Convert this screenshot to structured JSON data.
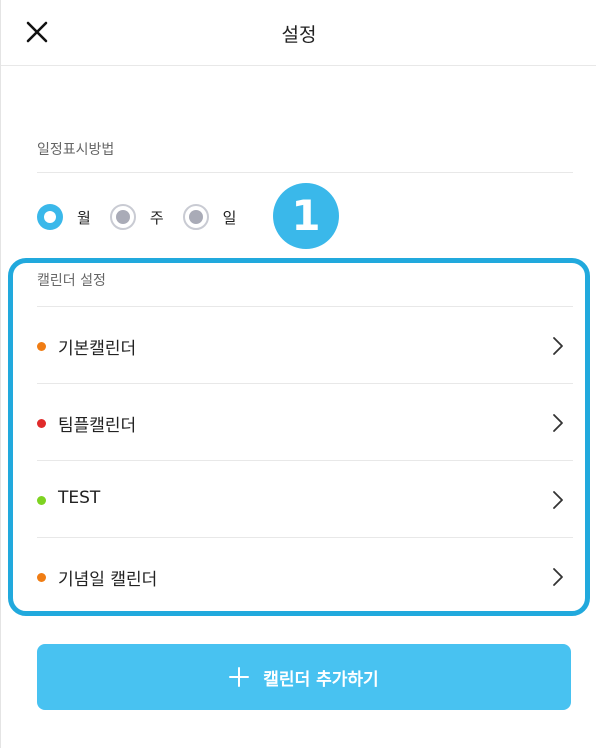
{
  "header": {
    "title": "설정",
    "close_icon": "close-icon"
  },
  "display_method": {
    "label": "일정표시방법",
    "options": [
      {
        "label": "월",
        "selected": true
      },
      {
        "label": "주",
        "selected": false
      },
      {
        "label": "일",
        "selected": false
      }
    ],
    "badge": "1"
  },
  "calendar_settings": {
    "label": "캘린더 설정",
    "items": [
      {
        "name": "기본캘린더",
        "color": "#f07d14"
      },
      {
        "name": "팀플캘린더",
        "color": "#e02b2b"
      },
      {
        "name": "TEST",
        "color": "#7ed321"
      },
      {
        "name": "기념일 캘린더",
        "color": "#f07d14"
      }
    ]
  },
  "add_button": {
    "label": "캘린더 추가하기",
    "icon": "plus-icon"
  },
  "colors": {
    "accent": "#48c2f1",
    "highlight_border": "#21a9dd"
  }
}
